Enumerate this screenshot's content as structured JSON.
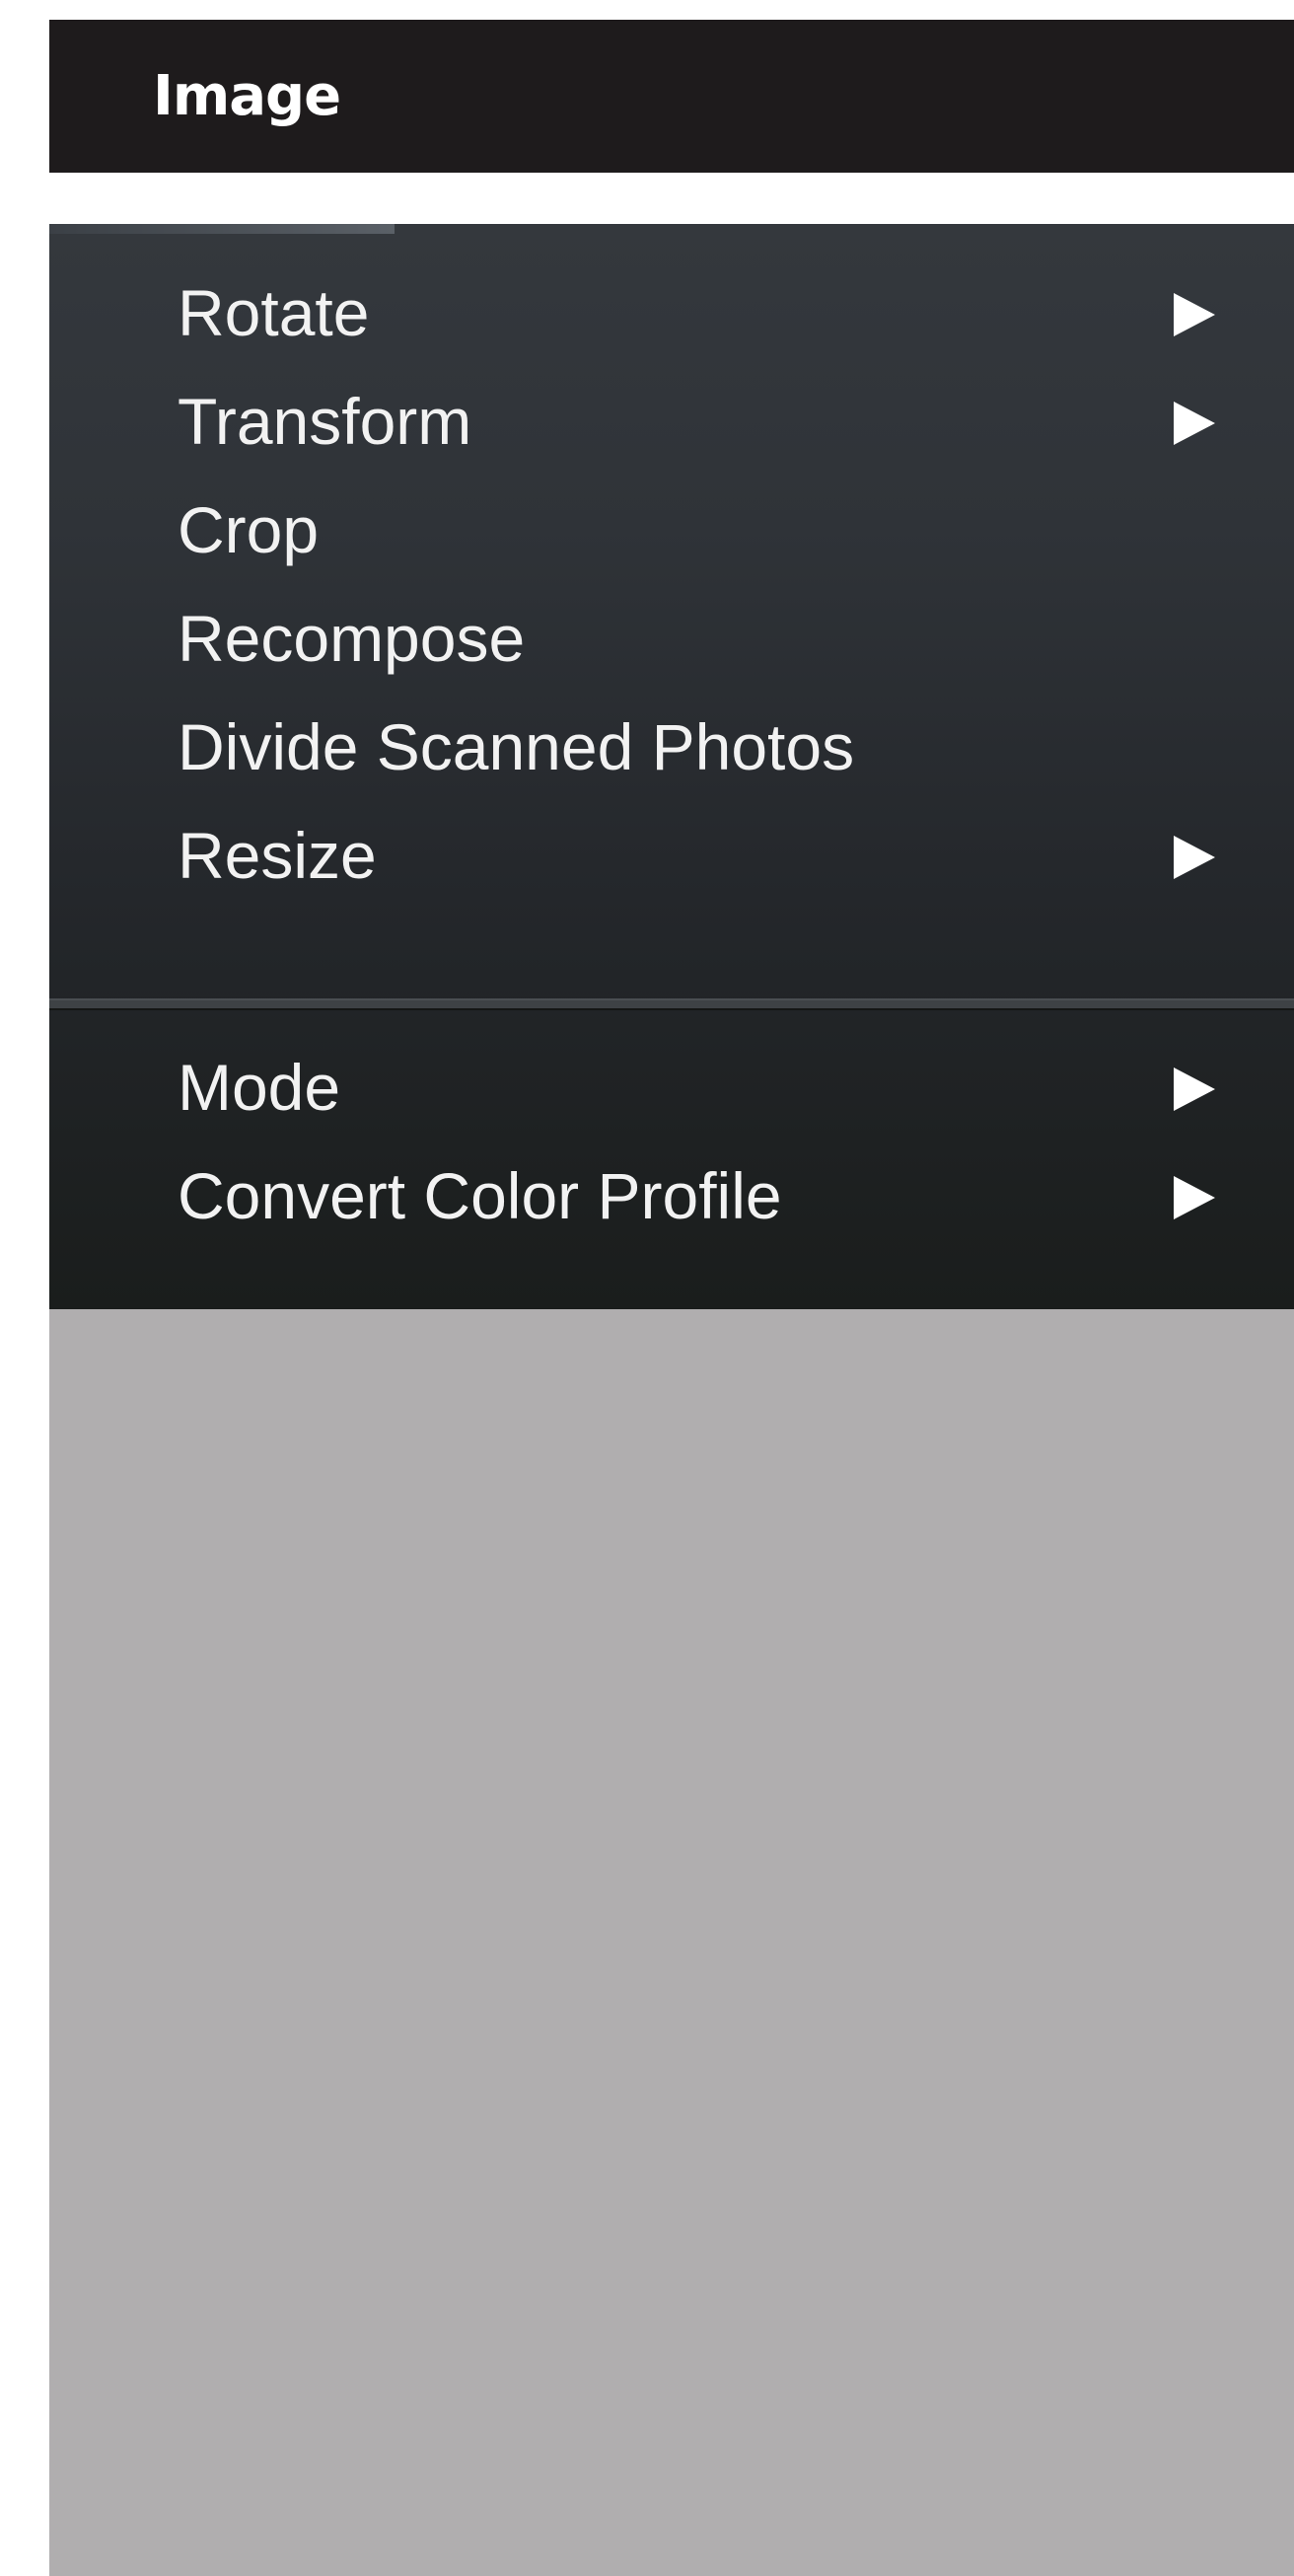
{
  "titlebar": {
    "label": "Image"
  },
  "menu": {
    "items": [
      {
        "label": "Rotate",
        "has_submenu": true,
        "submenu_icon": "submenu-arrow-icon"
      },
      {
        "label": "Transform",
        "has_submenu": true,
        "submenu_icon": "submenu-arrow-icon"
      },
      {
        "label": "Crop",
        "has_submenu": false
      },
      {
        "label": "Recompose",
        "has_submenu": false
      },
      {
        "label": "Divide Scanned Photos",
        "has_submenu": false
      },
      {
        "label": "Resize",
        "has_submenu": true,
        "submenu_icon": "submenu-arrow-icon"
      },
      {
        "label": "Mode",
        "has_submenu": true,
        "submenu_icon": "submenu-arrow-icon"
      },
      {
        "label": "Convert Color Profile",
        "has_submenu": true,
        "submenu_icon": "submenu-arrow-icon"
      }
    ]
  },
  "colors": {
    "titlebar_bg": "#1e1b1c",
    "menu_bg_top": "#34383d",
    "menu_bg_bottom": "#1a1d1c",
    "menu_text": "#f2f2f2",
    "canvas_bg": "#b0aeaf"
  }
}
